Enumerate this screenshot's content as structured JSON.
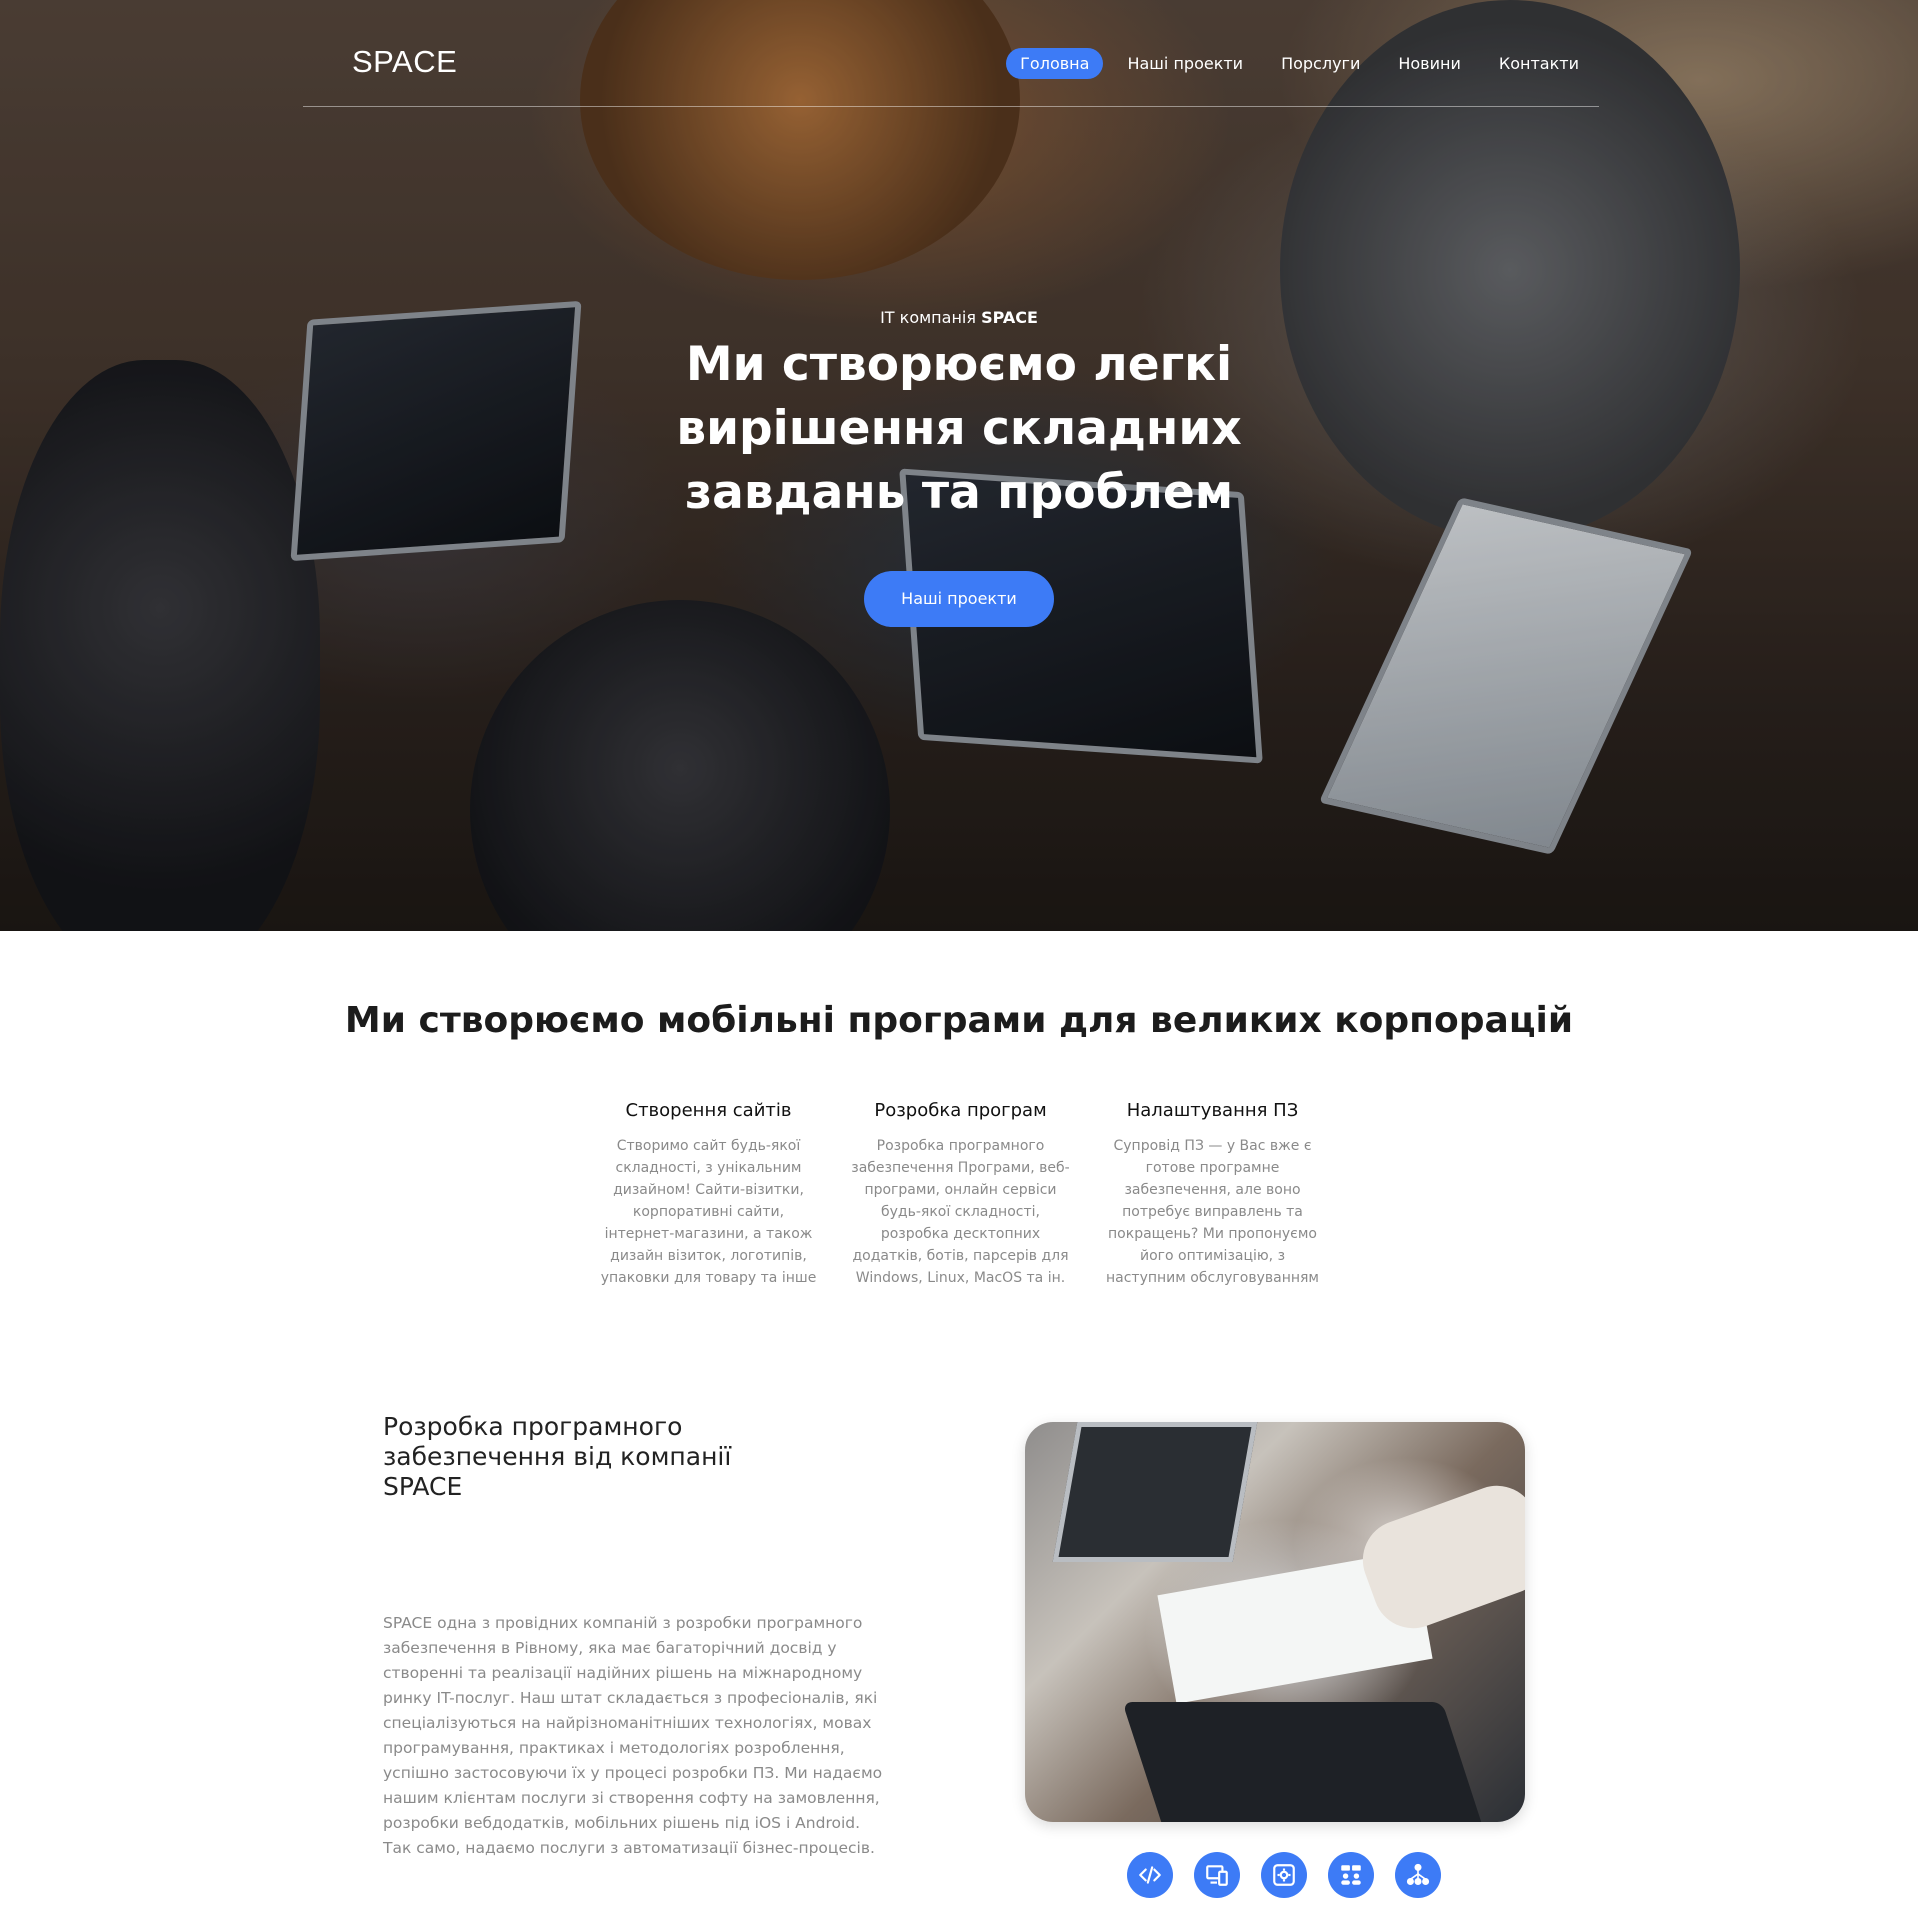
{
  "brand": "SPACE",
  "nav": {
    "items": [
      {
        "label": "Головна",
        "active": true
      },
      {
        "label": "Наші проекти",
        "active": false
      },
      {
        "label": "Порслуги",
        "active": false
      },
      {
        "label": "Новини",
        "active": false
      },
      {
        "label": "Контакти",
        "active": false
      }
    ]
  },
  "hero": {
    "kicker_prefix": "IT компанія",
    "kicker_brand": "SPACE",
    "title": "Ми створюємо легкі вирішення складних завдань та проблем",
    "button": "Наші проекти"
  },
  "section": {
    "title": "Ми створюємо мобільні програми для великих корпорацій",
    "features": [
      {
        "title": "Створення сайтів",
        "text": "Створимо сайт будь-якої складності, з унікальним дизайном! Сайти-візитки, корпоративні сайти, інтернет-магазини, а також дизайн візиток, логотипів, упаковки для товару та інше"
      },
      {
        "title": "Розробка програм",
        "text": "Розробка програмного забезпечення Програми, веб-програми, онлайн сервіси будь-якої складності, розробка десктопних додатків, ботів, парсерів для Windows, Linux, MacOS та ін."
      },
      {
        "title": "Налаштування ПЗ",
        "text": "Супровід ПЗ — у Вас вже є готове програмне забезпечення, але воно потребує виправлень та покращень? Ми пропонуємо його оптимізацію, з наступним обслуговуванням"
      }
    ]
  },
  "about": {
    "title": "Розробка програмного забезпечення від компанії SPACE",
    "text": "SPACE одна з провідних компаній з розробки програмного забезпечення в Рівному, яка має багаторічний досвід у створенні та реалізації надійних рішень на міжнародному ринку IT-послуг. Наш штат складається з професіоналів, які спеціалізуються на найрізноманітніших технологіях, мовах програмування, практиках і методологіях розроблення, успішно застосовуючи їх у процесі розробки ПЗ. Ми надаємо нашим клієнтам послуги зі створення софту на замовлення, розробки вебдодатків, мобільних рішень під iOS і Android. Так само, надаємо послуги з автоматизації бізнес-процесів."
  },
  "service_icons": [
    "code-icon",
    "devices-icon",
    "settings-icon",
    "team-chat-icon",
    "network-icon"
  ],
  "colors": {
    "accent": "#3d7bf6",
    "muted_text": "#8a8a8a",
    "heading": "#222222"
  }
}
